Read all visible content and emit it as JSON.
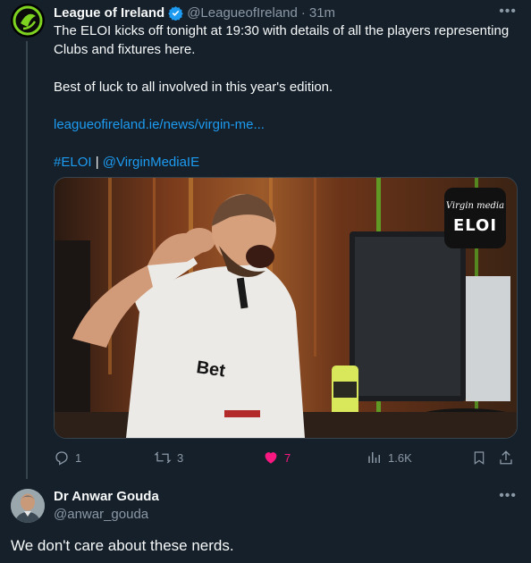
{
  "tweet": {
    "author_name": "League of Ireland",
    "handle": "@LeagueofIreland",
    "separator": "·",
    "time": "31m",
    "more_icon": "more-icon",
    "text_line1": "The ELOI kicks off tonight at 19:30 with details of all the players representing Clubs and fixtures here.",
    "text_line2": "Best of luck to all involved in this year's edition.",
    "link": "leagueofireland.ie/news/virgin-me...",
    "hashtag": "#ELOI",
    "pipe": " | ",
    "mention": "@VirginMediaIE",
    "media_logo_brand": "Virgin media",
    "media_logo_text": "ELOI",
    "shirt_text": "Bet"
  },
  "actions": {
    "replies": "1",
    "retweets": "3",
    "likes": "7",
    "views": "1.6K"
  },
  "reply": {
    "author_name": "Dr Anwar Gouda",
    "handle": "@anwar_gouda",
    "text": "We don't care about these nerds."
  },
  "colors": {
    "background": "#15202b",
    "link": "#1d9bf0",
    "like": "#f91880",
    "muted": "#8b98a5"
  }
}
